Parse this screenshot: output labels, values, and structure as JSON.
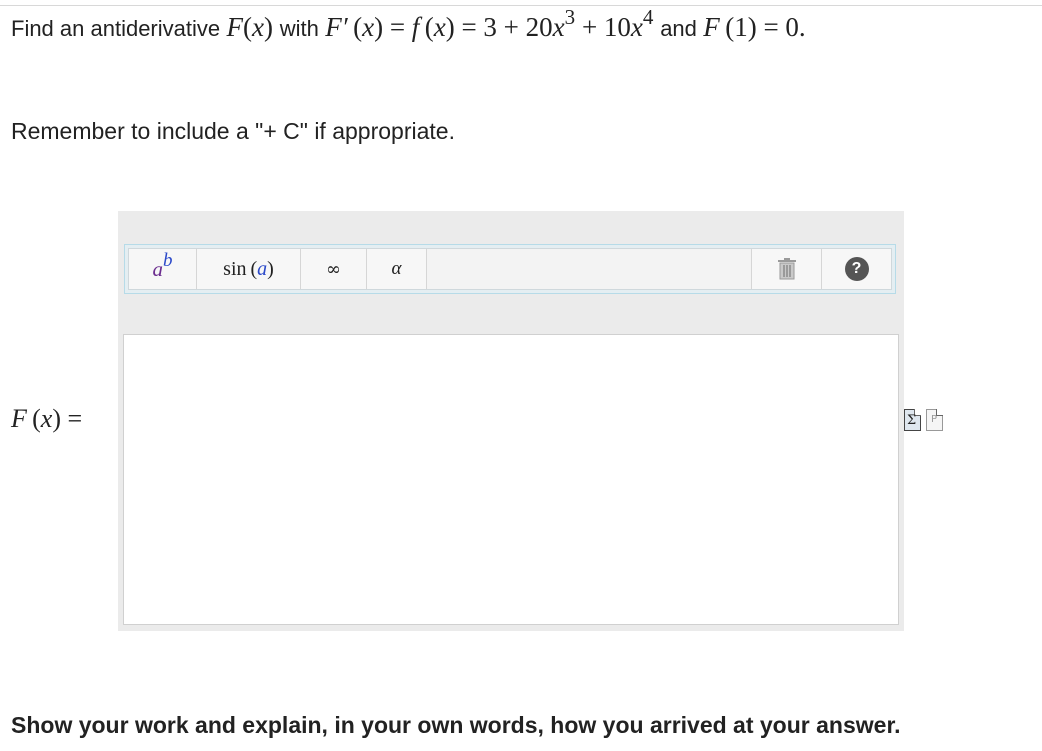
{
  "question": {
    "prefix": "Find an antiderivative",
    "F": "F",
    "x": "x",
    "with": "with",
    "Fprime": "F′",
    "eq1": "=",
    "f": "f",
    "eq2": "= 3 + 20",
    "exp3": "3",
    "plus": "+ 10",
    "exp4": "4",
    "and": "and",
    "cond_arg": "(1)",
    "cond_val": "= 0.",
    "open": "(",
    "close": ")"
  },
  "reminder": "Remember to include a \"+ C\" if appropriate.",
  "toolbar": {
    "power_base": "a",
    "power_exp": "b",
    "sin_label": "sin",
    "sin_var": "a",
    "infinity": "∞",
    "alpha": "α",
    "help": "?"
  },
  "answer": {
    "label_F": "F",
    "label_x": "x",
    "label_eq": "=",
    "value": ""
  },
  "side_icons": {
    "sigma": "Σ",
    "page": "P"
  },
  "instructions": "Show your work and explain, in your own words, how you arrived at your answer."
}
